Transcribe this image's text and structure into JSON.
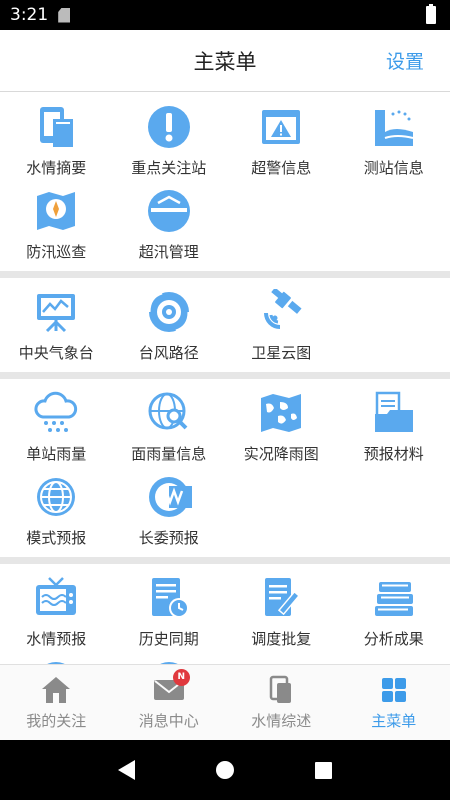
{
  "status_bar": {
    "time": "3:21"
  },
  "header": {
    "title": "主菜单",
    "settings_label": "设置"
  },
  "accent_color": "#3d9be9",
  "sections": [
    {
      "items": [
        {
          "label": "水情摘要",
          "icon": "water-summary-icon"
        },
        {
          "label": "重点关注站",
          "icon": "exclamation-icon"
        },
        {
          "label": "超警信息",
          "icon": "warning-window-icon"
        },
        {
          "label": "测站信息",
          "icon": "station-icon"
        },
        {
          "label": "防汛巡查",
          "icon": "map-compass-icon"
        },
        {
          "label": "超汛管理",
          "icon": "flood-level-icon"
        }
      ]
    },
    {
      "items": [
        {
          "label": "中央气象台",
          "icon": "presentation-chart-icon"
        },
        {
          "label": "台风路径",
          "icon": "typhoon-icon"
        },
        {
          "label": "卫星云图",
          "icon": "satellite-icon"
        }
      ]
    },
    {
      "items": [
        {
          "label": "单站雨量",
          "icon": "rain-cloud-icon"
        },
        {
          "label": "面雨量信息",
          "icon": "globe-search-icon"
        },
        {
          "label": "实况降雨图",
          "icon": "world-map-icon"
        },
        {
          "label": "预报材料",
          "icon": "folder-document-icon"
        },
        {
          "label": "模式预报",
          "icon": "globe-icon"
        },
        {
          "label": "长委预报",
          "icon": "cjw-logo-icon"
        }
      ]
    },
    {
      "items": [
        {
          "label": "水情预报",
          "icon": "tv-wave-icon"
        },
        {
          "label": "历史同期",
          "icon": "document-clock-icon"
        },
        {
          "label": "调度批复",
          "icon": "document-pen-icon"
        },
        {
          "label": "分析成果",
          "icon": "books-stack-icon"
        },
        {
          "label": "",
          "icon": "upload-circle-icon"
        },
        {
          "label": "",
          "icon": "asterisk-circle-icon"
        }
      ]
    }
  ],
  "bottom_nav": [
    {
      "label": "我的关注",
      "icon": "house-icon",
      "active": false
    },
    {
      "label": "消息中心",
      "icon": "mail-icon",
      "active": false,
      "badge": "N"
    },
    {
      "label": "水情综述",
      "icon": "document-copy-icon",
      "active": false
    },
    {
      "label": "主菜单",
      "icon": "grid-icon",
      "active": true
    }
  ]
}
